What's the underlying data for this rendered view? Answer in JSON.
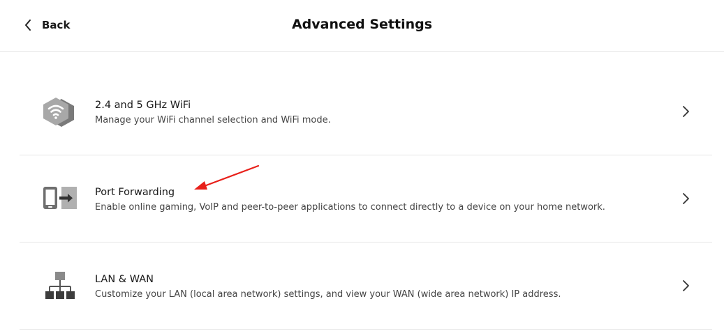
{
  "header": {
    "back_label": "Back",
    "title": "Advanced Settings"
  },
  "settings": [
    {
      "name": "2.4 and 5 GHz WiFi",
      "description": "Manage your WiFi channel selection and WiFi mode.",
      "icon": "wifi-hexagon-icon"
    },
    {
      "name": "Port Forwarding",
      "description": "Enable online gaming, VoIP and peer-to-peer applications to connect directly to a device on your home network.",
      "icon": "port-forwarding-icon"
    },
    {
      "name": "LAN & WAN",
      "description": "Customize your LAN (local area network) settings, and view your WAN (wide area network) IP address.",
      "icon": "network-tree-icon"
    }
  ],
  "colors": {
    "icon_gray": "#6f6f6f",
    "icon_dark": "#4a4a4a",
    "divider": "#e6e6e6",
    "annotation_arrow": "#e8201a"
  }
}
